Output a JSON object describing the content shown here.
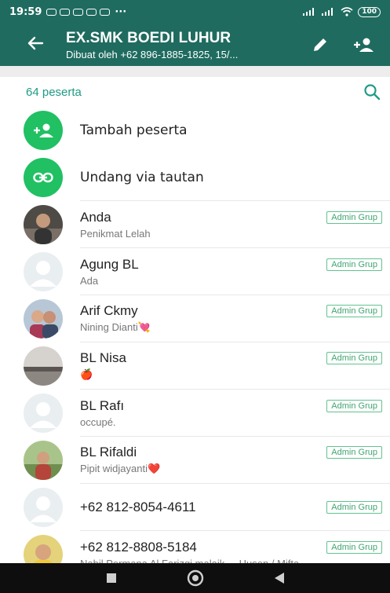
{
  "status_bar": {
    "time": "19:59",
    "dots": "···",
    "battery": "100"
  },
  "header": {
    "title": "EX.SMK BOEDI LUHUR",
    "subtitle": "Dibuat oleh +62 896-1885-1825, 15/...",
    "back_icon": "arrow-left-icon",
    "edit_icon": "pencil-icon",
    "add_participant_icon": "add-person-icon"
  },
  "participants": {
    "count_label": "64 peserta",
    "search_icon": "search-icon"
  },
  "actions": [
    {
      "label": "Tambah peserta",
      "icon": "add-person-icon"
    },
    {
      "label": "Undang via tautan",
      "icon": "link-icon"
    }
  ],
  "members": [
    {
      "name": "Anda",
      "status": "Penikmat Lelah",
      "badge": "Admin Grup",
      "avatar": "photo"
    },
    {
      "name": "Agung BL",
      "status": "Ada",
      "badge": "Admin Grup",
      "avatar": "placeholder"
    },
    {
      "name": "Arif Ckmy",
      "status": "Nining Dianti💘",
      "badge": "Admin Grup",
      "avatar": "photo"
    },
    {
      "name": "BL Nisa",
      "status": "🍎",
      "badge": "Admin Grup",
      "avatar": "photo"
    },
    {
      "name": "BL Rafı",
      "status": "occupé.",
      "badge": "Admin Grup",
      "avatar": "placeholder"
    },
    {
      "name": "BL Rifaldi",
      "status": "Pipit widjayanti❤️",
      "badge": "Admin Grup",
      "avatar": "photo"
    },
    {
      "name": "+62 812-8054-4611",
      "status": "",
      "badge": "Admin Grup",
      "avatar": "placeholder"
    },
    {
      "name": "+62 812-8808-5184",
      "status": "Nabil Permana Al Farizqi malaik...~Husen / Mifta",
      "badge": "Admin Grup",
      "avatar": "photo"
    }
  ],
  "colors": {
    "header": "#1f6b5f",
    "accent": "#1f9b86",
    "action": "#21c063",
    "badge": "#62c38f"
  }
}
